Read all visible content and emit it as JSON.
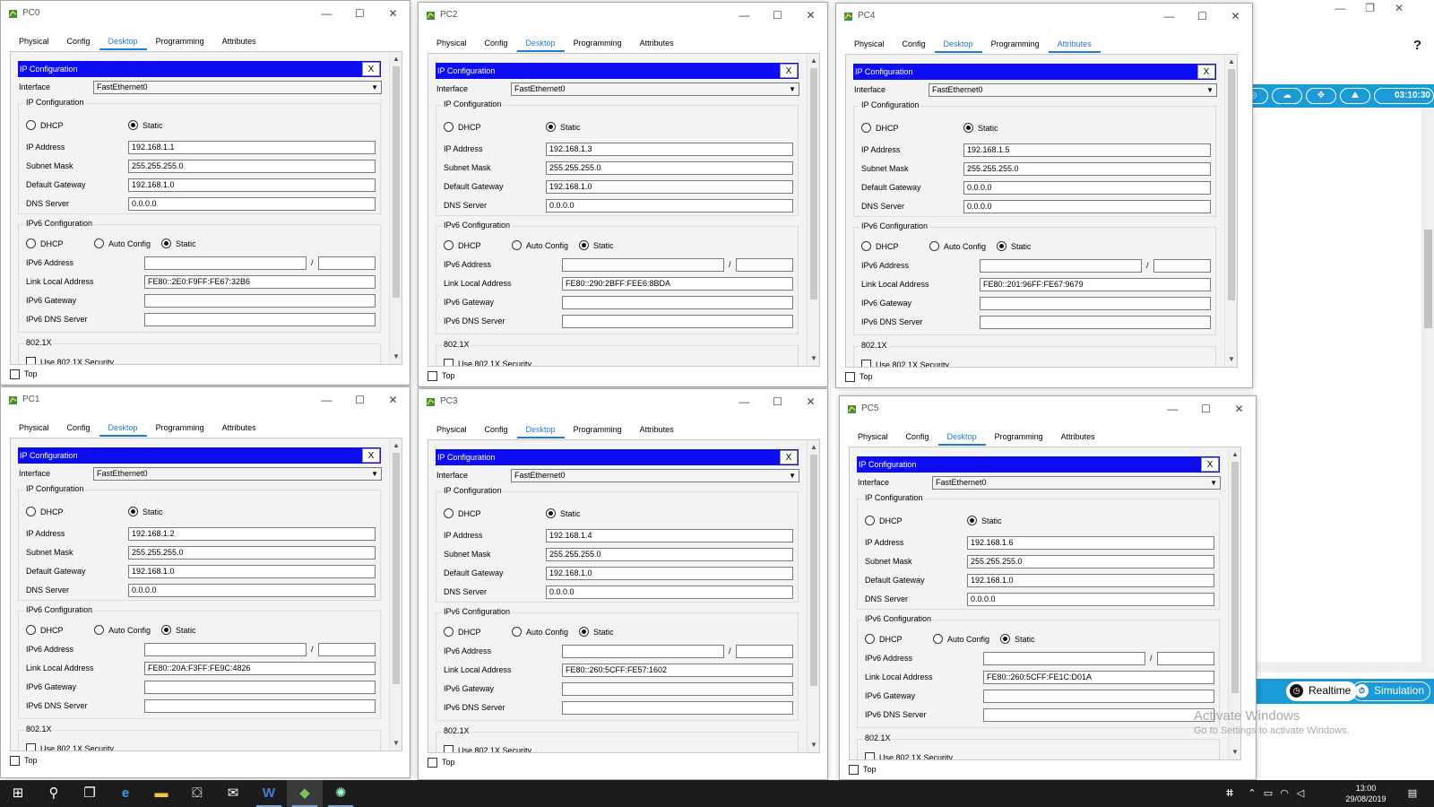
{
  "background_app": {
    "help_label": "?",
    "clock": "03:10:30",
    "realtime_label": "Realtime",
    "simulation_label": "Simulation",
    "watermark_title": "Activate Windows",
    "watermark_sub": "Go to Settings to activate Windows."
  },
  "common": {
    "tabs": [
      "Physical",
      "Config",
      "Desktop",
      "Programming",
      "Attributes"
    ],
    "ip_config_title": "IP Configuration",
    "close_x": "X",
    "interface_label": "Interface",
    "ip_config_group": "IP Configuration",
    "dhcp_label": "DHCP",
    "static_label": "Static",
    "ip_address_label": "IP Address",
    "subnet_mask_label": "Subnet Mask",
    "default_gateway_label": "Default Gateway",
    "dns_server_label": "DNS Server",
    "ipv6_group": "IPv6 Configuration",
    "auto_config_label": "Auto Config",
    "ipv6_address_label": "IPv6 Address",
    "slash": "/",
    "link_local_label": "Link Local Address",
    "ipv6_gateway_label": "IPv6 Gateway",
    "ipv6_dns_label": "IPv6 DNS Server",
    "dot1x_group": "802.1X",
    "dot1x_label": "Use 802.1X Security",
    "top_label": "Top"
  },
  "windows": [
    {
      "title": "PC0",
      "interface": "FastEthernet0",
      "ip": "192.168.1.1",
      "mask": "255.255.255.0",
      "gateway": "192.168.1.0",
      "dns": "0.0.0.0",
      "link_local": "FE80::2E0:F9FF:FE67:32B6"
    },
    {
      "title": "PC2",
      "interface": "FastEthernet0",
      "ip": "192.168.1.3",
      "mask": "255.255.255.0",
      "gateway": "192.168.1.0",
      "dns": "0.0.0.0",
      "link_local": "FE80::290:2BFF:FEE6:8BDA"
    },
    {
      "title": "PC4",
      "interface": "FastEthernet0",
      "ip": "192.168.1.5",
      "mask": "255.255.255.0",
      "gateway": "0.0.0.0",
      "dns": "0.0.0.0",
      "link_local": "FE80::201:96FF:FE67:9679"
    },
    {
      "title": "PC1",
      "interface": "FastEthernet0",
      "ip": "192.168.1.2",
      "mask": "255.255.255.0",
      "gateway": "192.168.1.0",
      "dns": "0.0.0.0",
      "link_local": "FE80::20A:F3FF:FE9C:4826"
    },
    {
      "title": "PC3",
      "interface": "FastEthernet0",
      "ip": "192.168.1.4",
      "mask": "255.255.255.0",
      "gateway": "192.168.1.0",
      "dns": "0.0.0.0",
      "link_local": "FE80::260:5CFF:FE57:1602"
    },
    {
      "title": "PC5",
      "interface": "FastEthernet0",
      "ip": "192.168.1.6",
      "mask": "255.255.255.0",
      "gateway": "192.168.1.0",
      "dns": "0.0.0.0",
      "link_local": "FE80::260:5CFF:FE1C:D01A"
    }
  ],
  "taskbar": {
    "time": "13:00",
    "date": "29/08/2019"
  },
  "colors": {
    "ip_bar": "#0d0df2",
    "tab_active": "#1e7bd7",
    "pt_blue": "#1a9ad6",
    "taskbar": "#1c1c1c"
  }
}
